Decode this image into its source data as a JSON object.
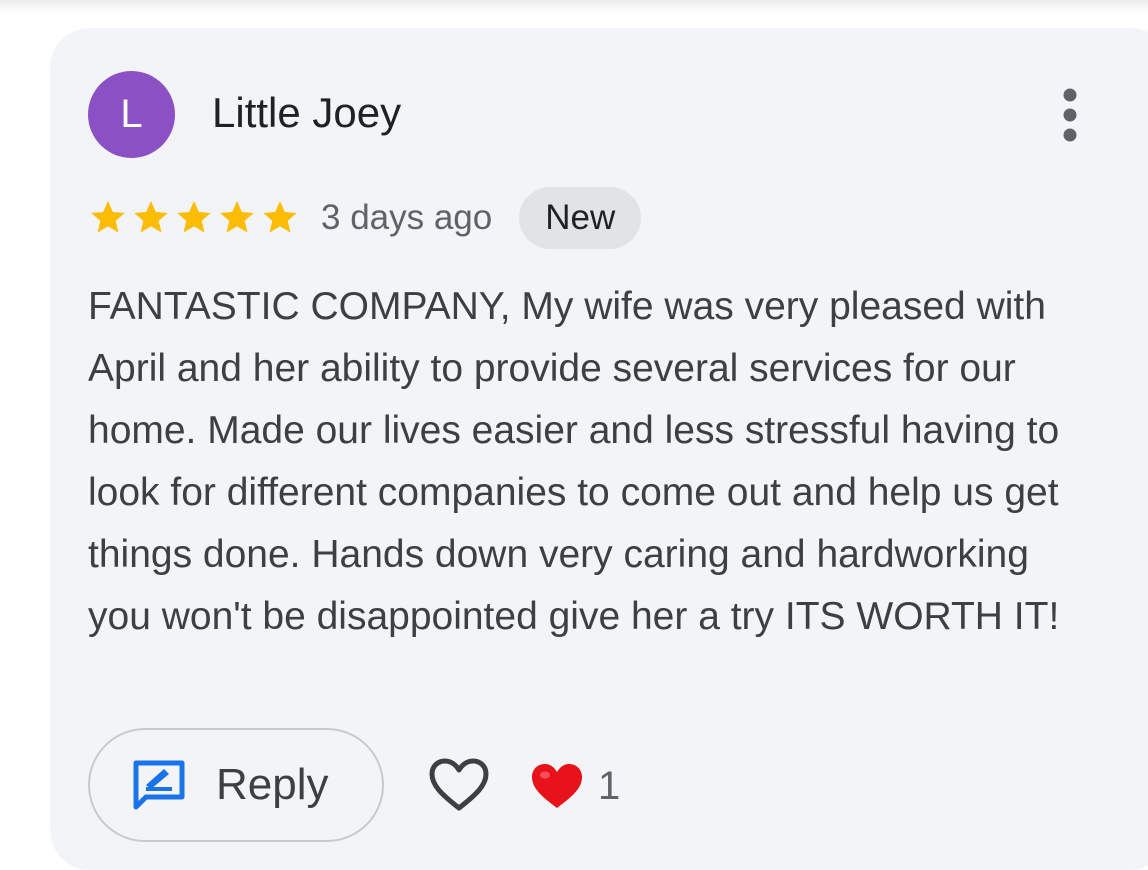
{
  "review": {
    "author": {
      "initial": "L",
      "name": "Little Joey",
      "avatar_color": "#8b50c3"
    },
    "rating": 5,
    "rating_max": 5,
    "star_color": "#fbbc04",
    "date": "3 days ago",
    "badge": "New",
    "text": "FANTASTIC COMPANY, My wife was very pleased with April and her ability to provide several services for our home. Made our lives easier and less stressful having to look for different companies to come out and help us get things done. Hands down very caring and hardworking you won't be disappointed give her a try ITS WORTH IT!",
    "menu_icon": "more-vert-icon"
  },
  "actions": {
    "reply_label": "Reply",
    "reply_icon": "reply-edit-icon",
    "reply_icon_color": "#1a73e8",
    "like_icon": "heart-outline-icon",
    "reaction_icon": "red-heart-icon",
    "reaction_color": "#e8121b",
    "reaction_count": "1"
  }
}
